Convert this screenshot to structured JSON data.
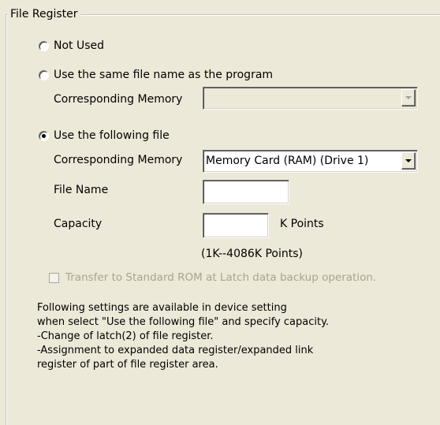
{
  "group": {
    "title": "File Register"
  },
  "options": {
    "not_used": {
      "label": "Not Used",
      "selected": false
    },
    "same_name": {
      "label": "Use the same file name as the program",
      "selected": false
    },
    "following_file": {
      "label": "Use the following file",
      "selected": true
    }
  },
  "same_name_memory": {
    "label": "Corresponding Memory",
    "value": ""
  },
  "following_memory": {
    "label": "Corresponding Memory",
    "value": "Memory Card (RAM) (Drive 1)"
  },
  "file_name": {
    "label": "File Name",
    "value": ""
  },
  "capacity": {
    "label": "Capacity",
    "value": "",
    "unit": "K Points",
    "range_hint": "(1K--4086K Points)"
  },
  "transfer_checkbox": {
    "label": "Transfer to Standard ROM at Latch data backup operation.",
    "checked": false,
    "enabled": false
  },
  "note": {
    "lines": [
      "Following settings are available in device setting",
      "when select \"Use the following file\" and specify capacity.",
      "-Change of latch(2) of file register.",
      "-Assignment to expanded data register/expanded link",
      "register of part of file register area."
    ]
  }
}
